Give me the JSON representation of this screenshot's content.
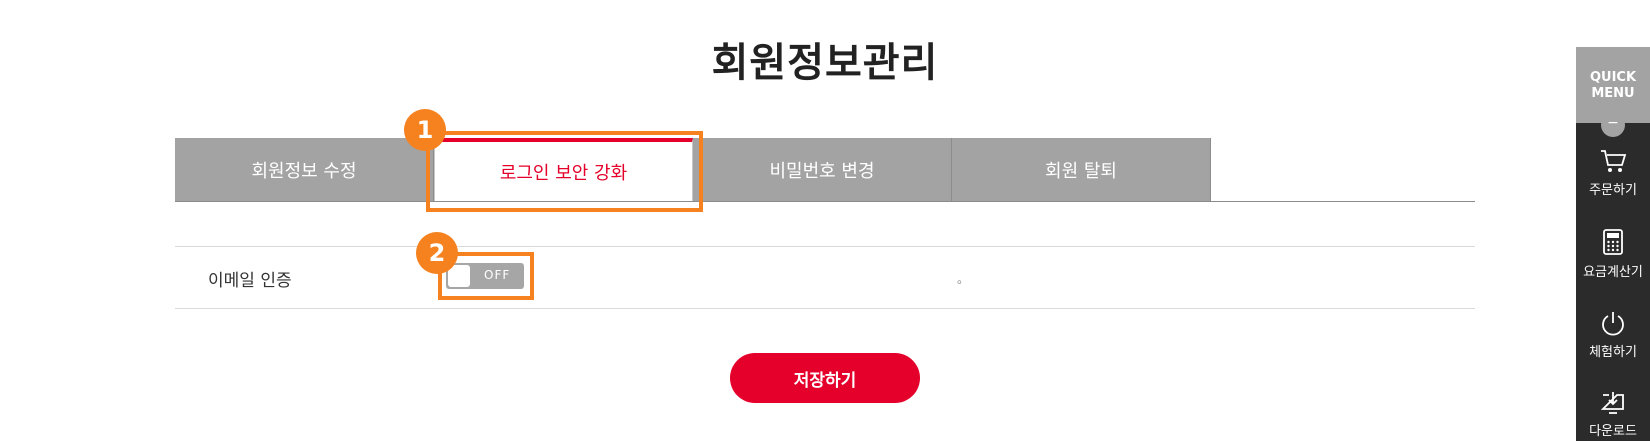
{
  "page_title": "회원정보관리",
  "tabs": [
    {
      "label": "회원정보 수정",
      "active": false
    },
    {
      "label": "로그인 보안 강화",
      "active": true
    },
    {
      "label": "비밀번호 변경",
      "active": false
    },
    {
      "label": "회원 탈퇴",
      "active": false
    }
  ],
  "markers": [
    "1",
    "2"
  ],
  "email_auth": {
    "label": "이메일 인증",
    "toggle_state": "OFF",
    "note": "。"
  },
  "save_button": "저장하기",
  "quick_menu": {
    "title": "QUICK MENU",
    "collapse_symbol": "−",
    "items": [
      {
        "label": "주문하기",
        "icon": "cart-icon"
      },
      {
        "label": "요금계산기",
        "icon": "calculator-icon"
      },
      {
        "label": "체험하기",
        "icon": "power-icon"
      },
      {
        "label": "다운로드",
        "icon": "download-icon"
      }
    ]
  },
  "colors": {
    "accent": "#e4002b",
    "highlight": "#f5821f",
    "tab_inactive": "#a3a3a3",
    "quick_menu_bg": "#2b2b2b"
  }
}
